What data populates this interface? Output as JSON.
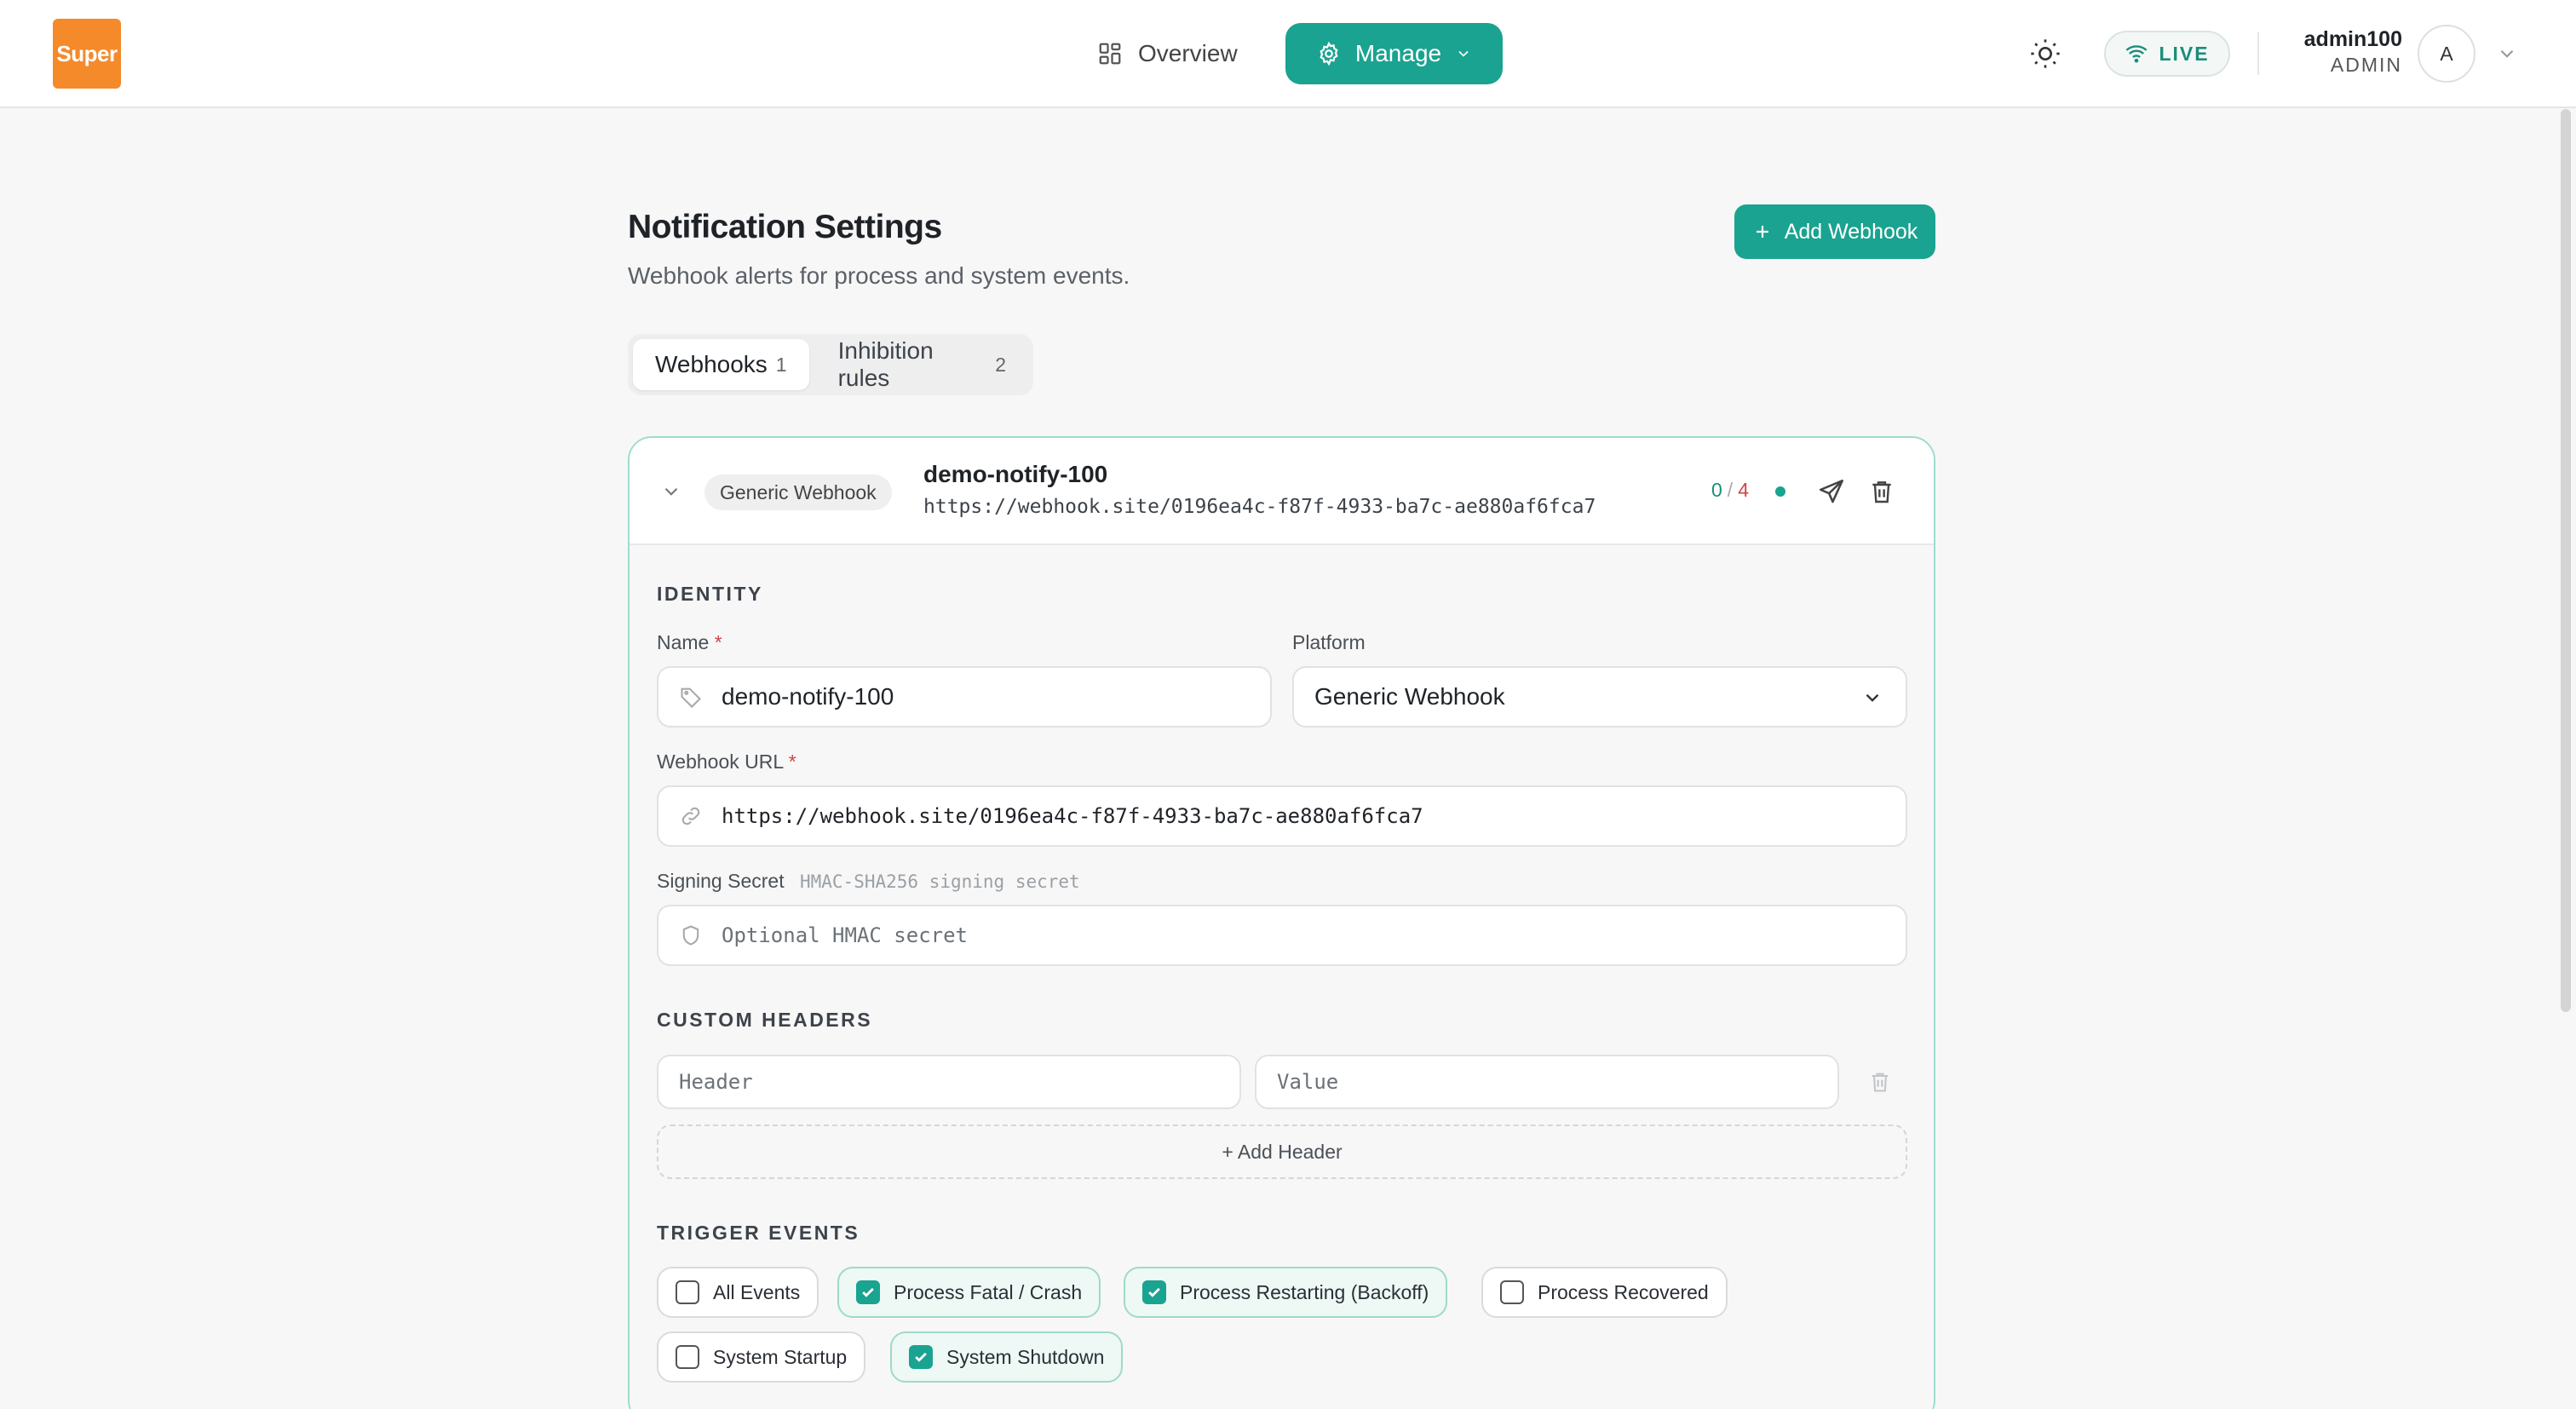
{
  "header": {
    "logo_text": "Super",
    "nav": {
      "overview": "Overview",
      "manage": "Manage"
    },
    "live_label": "LIVE",
    "user": {
      "name": "admin100",
      "role": "ADMIN",
      "avatar_letter": "A"
    }
  },
  "page": {
    "title": "Notification Settings",
    "subtitle": "Webhook alerts for process and system events.",
    "add_webhook_label": "Add Webhook",
    "tabs": [
      {
        "label": "Webhooks",
        "count": "1",
        "active": true
      },
      {
        "label": "Inhibition rules",
        "count": "2",
        "active": false
      }
    ]
  },
  "webhook": {
    "platform_badge": "Generic Webhook",
    "name": "demo-notify-100",
    "url": "https://webhook.site/0196ea4c-f87f-4933-ba7c-ae880af6fca7",
    "delivery": {
      "success": "0",
      "separator": "/",
      "failed": "4"
    },
    "identity": {
      "section": "IDENTITY",
      "name_label": "Name",
      "name_value": "demo-notify-100",
      "platform_label": "Platform",
      "platform_value": "Generic Webhook",
      "url_label": "Webhook URL",
      "url_value": "https://webhook.site/0196ea4c-f87f-4933-ba7c-ae880af6fca7",
      "secret_label": "Signing Secret",
      "secret_hint": "HMAC-SHA256 signing secret",
      "secret_placeholder": "Optional HMAC secret",
      "required_mark": "*"
    },
    "custom_headers": {
      "section": "CUSTOM HEADERS",
      "header_placeholder": "Header",
      "value_placeholder": "Value",
      "add_label": "+ Add Header"
    },
    "trigger_events": {
      "section": "TRIGGER EVENTS",
      "items": [
        {
          "label": "All Events",
          "checked": false
        },
        {
          "label": "Process Fatal / Crash",
          "checked": true
        },
        {
          "label": "Process Restarting (Backoff)",
          "checked": true
        },
        {
          "label": "Process Recovered",
          "checked": false
        },
        {
          "label": "System Startup",
          "checked": false
        },
        {
          "label": "System Shutdown",
          "checked": true
        }
      ]
    }
  },
  "colors": {
    "accent": "#1aa390",
    "logo": "#f58a2b",
    "error": "#d04444"
  },
  "icons": [
    "grid-icon",
    "gear-icon",
    "chevron-down-icon",
    "sun-icon",
    "wifi-icon",
    "plus-icon",
    "send-icon",
    "trash-icon",
    "tag-icon",
    "link-icon",
    "shield-icon",
    "check-icon"
  ]
}
